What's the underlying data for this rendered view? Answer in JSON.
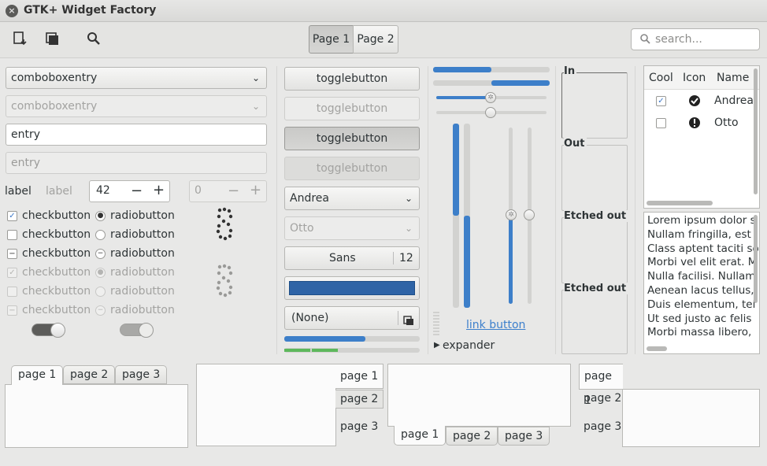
{
  "window": {
    "title": "GTK+ Widget Factory",
    "close_glyph": "×"
  },
  "toolbar": {
    "page1": "Page 1",
    "page2": "Page 2",
    "search_placeholder": "search...",
    "icons": [
      "open-icon",
      "copy-icon",
      "search-icon"
    ]
  },
  "col1": {
    "combo1": "comboboxentry",
    "combo2": "comboboxentry",
    "entry1": "entry",
    "entry2": "entry",
    "label_a": "label",
    "label_b": "label",
    "spin1": "42",
    "spin2": "0",
    "check": [
      "checkbutton",
      "checkbutton",
      "checkbutton",
      "checkbutton",
      "checkbutton",
      "checkbutton"
    ],
    "radio": [
      "radiobutton",
      "radiobutton",
      "radiobutton",
      "radiobutton",
      "radiobutton",
      "radiobutton"
    ]
  },
  "col2": {
    "toggle": [
      "togglebutton",
      "togglebutton",
      "togglebutton",
      "togglebutton"
    ],
    "combo_a": "Andrea",
    "combo_b": "Otto",
    "font": "Sans",
    "font_size": "12",
    "file": "(None)",
    "color": "#2f64a6",
    "progress": 0.6
  },
  "col3": {
    "link": "link button",
    "expander": "expander",
    "h_progress": [
      0.5,
      0.5
    ],
    "h_scale": 0.5
  },
  "frames": [
    "In",
    "Out",
    "Etched out",
    "Etched out"
  ],
  "tree": {
    "headers": [
      "Cool",
      "Icon",
      "Name"
    ],
    "rows": [
      {
        "cool": true,
        "name": "Andrea"
      },
      {
        "cool": false,
        "name": "Otto"
      }
    ]
  },
  "text": [
    "Lorem ipsum dolor s",
    "Nullam fringilla, est",
    "Class aptent taciti so",
    "Morbi vel elit erat. M",
    "Nulla facilisi. Nullam",
    "Aenean lacus tellus,",
    "Duis elementum, tel",
    "Ut sed justo ac felis",
    "Morbi massa libero,"
  ],
  "notebooks": {
    "tabs": [
      "page 1",
      "page 2",
      "page 3"
    ]
  },
  "colors": {
    "accent": "#3d7fc9",
    "bg": "#e8e8e7"
  }
}
